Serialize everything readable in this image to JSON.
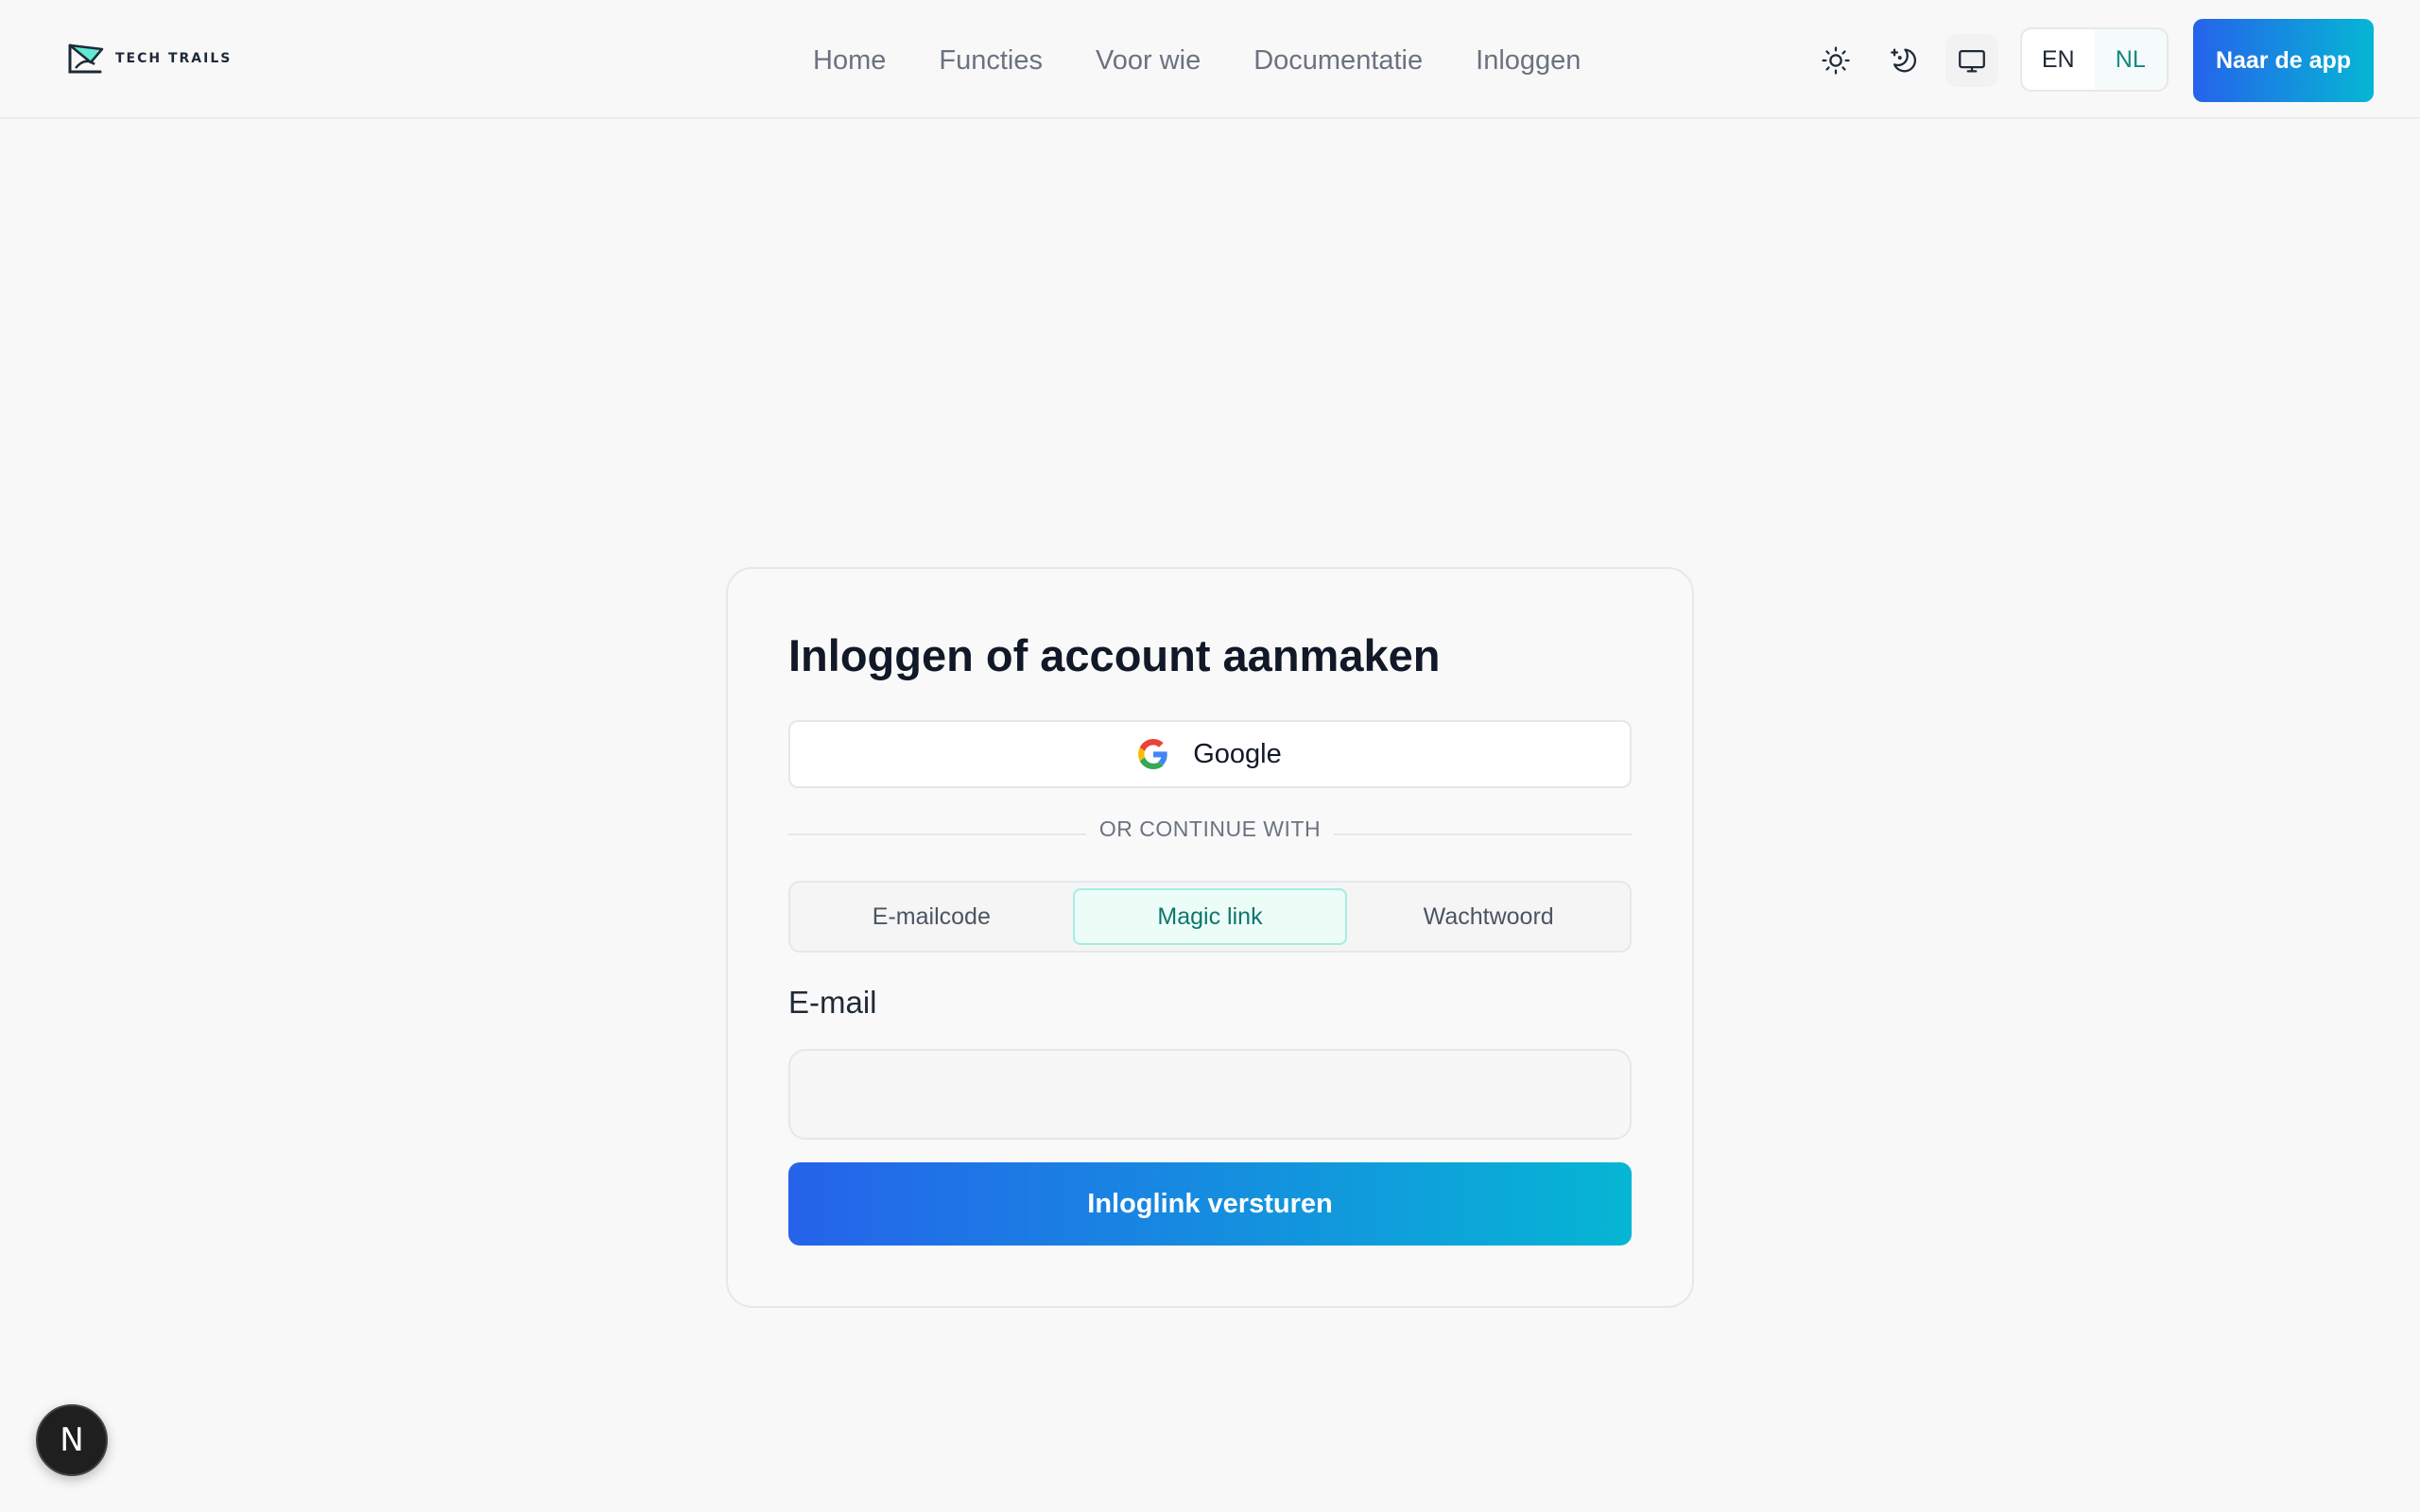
{
  "header": {
    "brand": "TECH TRAILS",
    "nav": [
      "Home",
      "Functies",
      "Voor wie",
      "Documentatie",
      "Inloggen"
    ],
    "theme_icons": [
      "sun-icon",
      "moon-icon",
      "monitor-icon"
    ],
    "languages": [
      "EN",
      "NL"
    ],
    "active_language": "NL",
    "cta_label": "Naar de app"
  },
  "login": {
    "title": "Inloggen of account aanmaken",
    "google_label": "Google",
    "divider_text": "OR CONTINUE WITH",
    "tabs": [
      "E-mailcode",
      "Magic link",
      "Wachtwoord"
    ],
    "active_tab": "Magic link",
    "email_label": "E-mail",
    "email_value": "",
    "email_placeholder": "",
    "submit_label": "Inloglink versturen"
  },
  "badge": {
    "letter": "N"
  },
  "colors": {
    "accent_start": "#2563eb",
    "accent_end": "#06b6d4",
    "active_tab_text": "#0f766e",
    "background": "#f8f8f8"
  }
}
